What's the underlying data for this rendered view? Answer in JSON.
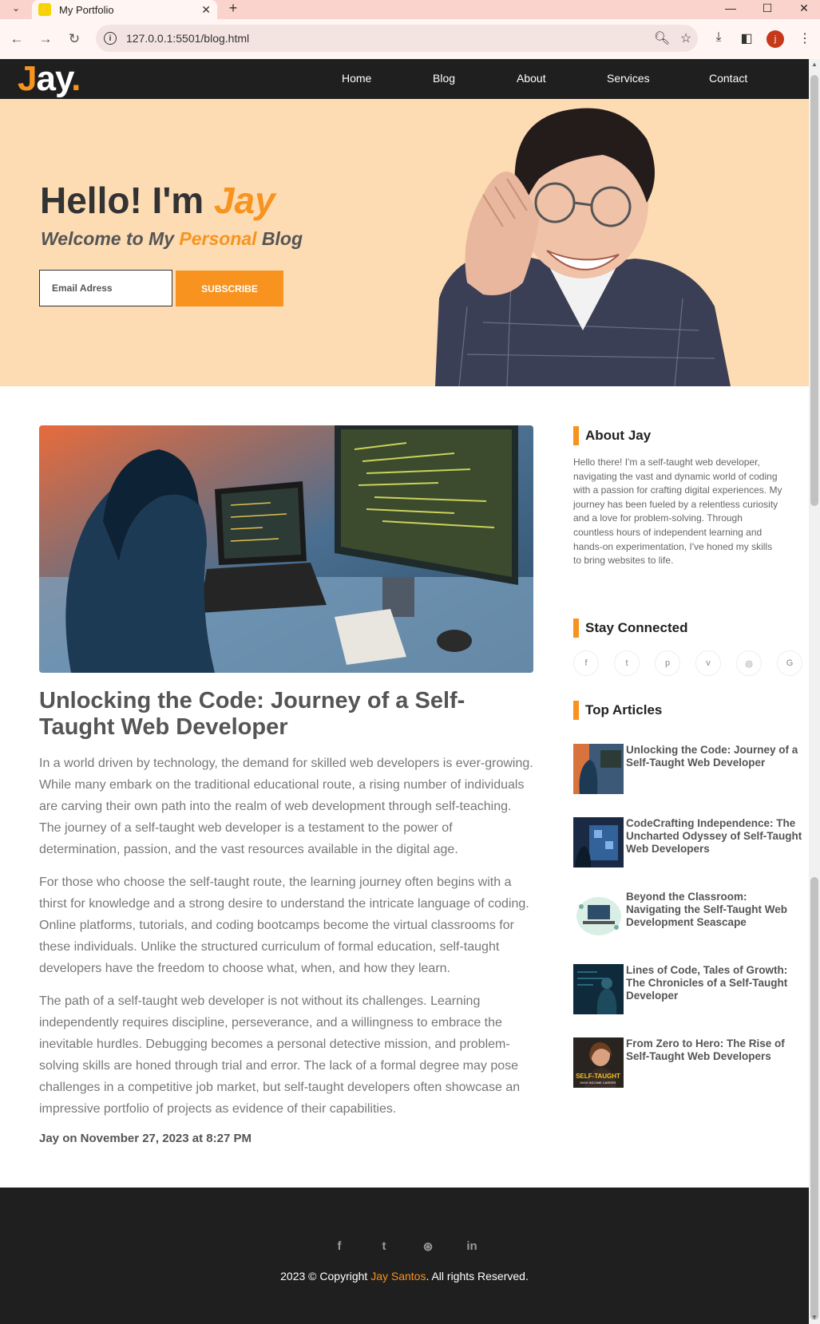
{
  "browser": {
    "tab_title": "My Portfolio",
    "url": "127.0.0.1:5501/blog.html",
    "profile_initial": "j"
  },
  "site": {
    "logo_main": "ay",
    "logo_j": "J",
    "logo_dot": ".",
    "nav": [
      "Home",
      "Blog",
      "About",
      "Services",
      "Contact"
    ]
  },
  "hero": {
    "greeting": "Hello! I'm ",
    "name": "Jay",
    "subtitle_pre": "Welcome to My ",
    "subtitle_accent": "Personal",
    "subtitle_post": " Blog",
    "email_placeholder": "Email Adress",
    "subscribe_label": "SUBSCRIBE"
  },
  "post": {
    "title": "Unlocking the Code: Journey of a Self-Taught Web Developer",
    "paragraphs": [
      "In a world driven by technology, the demand for skilled web developers is ever-growing. While many embark on the traditional educational route, a rising number of individuals are carving their own path into the realm of web development through self-teaching. The journey of a self-taught web developer is a testament to the power of determination, passion, and the vast resources available in the digital age.",
      "For those who choose the self-taught route, the learning journey often begins with a thirst for knowledge and a strong desire to understand the intricate language of coding. Online platforms, tutorials, and coding bootcamps become the virtual classrooms for these individuals. Unlike the structured curriculum of formal education, self-taught developers have the freedom to choose what, when, and how they learn.",
      "The path of a self-taught web developer is not without its challenges. Learning independently requires discipline, perseverance, and a willingness to embrace the inevitable hurdles. Debugging becomes a personal detective mission, and problem-solving skills are honed through trial and error. The lack of a formal degree may pose challenges in a competitive job market, but self-taught developers often showcase an impressive portfolio of projects as evidence of their capabilities."
    ],
    "meta": "Jay on November 27, 2023 at 8:27 PM"
  },
  "sidebar": {
    "about_heading": "About Jay",
    "about_text": "Hello there! I'm a self-taught web developer, navigating the vast and dynamic world of coding with a passion for crafting digital experiences. My journey has been fueled by a relentless curiosity and a love for problem-solving. Through countless hours of independent learning and hands-on experimentation, I've honed my skills to bring websites to life.",
    "connected_heading": "Stay Connected",
    "social_icons": [
      {
        "name": "facebook-icon",
        "glyph": "f"
      },
      {
        "name": "twitter-icon",
        "glyph": "t"
      },
      {
        "name": "pinterest-icon",
        "glyph": "p"
      },
      {
        "name": "vimeo-icon",
        "glyph": "v"
      },
      {
        "name": "instagram-icon",
        "glyph": "◎"
      },
      {
        "name": "google-icon",
        "glyph": "G"
      }
    ],
    "top_heading": "Top Articles",
    "articles": [
      "Unlocking the Code: Journey of a Self-Taught Web Developer",
      "CodeCrafting Independence: The Uncharted Odyssey of Self-Taught Web Developers",
      "Beyond the Classroom: Navigating the Self-Taught Web Development Seascape",
      "Lines of Code, Tales of Growth: The Chronicles of a Self-Taught Developer",
      "From Zero to Hero: The Rise of Self-Taught Web Developers"
    ],
    "thumb5_caption": "SELF-TAUGHT",
    "thumb5_sub": "HIGH INCOME CAREER"
  },
  "footer": {
    "social_icons": [
      {
        "name": "facebook-icon",
        "glyph": "f"
      },
      {
        "name": "twitter-icon",
        "glyph": "t"
      },
      {
        "name": "dribbble-icon",
        "glyph": "⊛"
      },
      {
        "name": "linkedin-icon",
        "glyph": "in"
      }
    ],
    "copy_pre": "2023 © Copyright ",
    "copy_name": "Jay Santos",
    "copy_post": ". All rights Reserved."
  },
  "colors": {
    "accent": "#f7931e",
    "hero_bg": "#fddcb4",
    "dark": "#1f1f1f"
  }
}
